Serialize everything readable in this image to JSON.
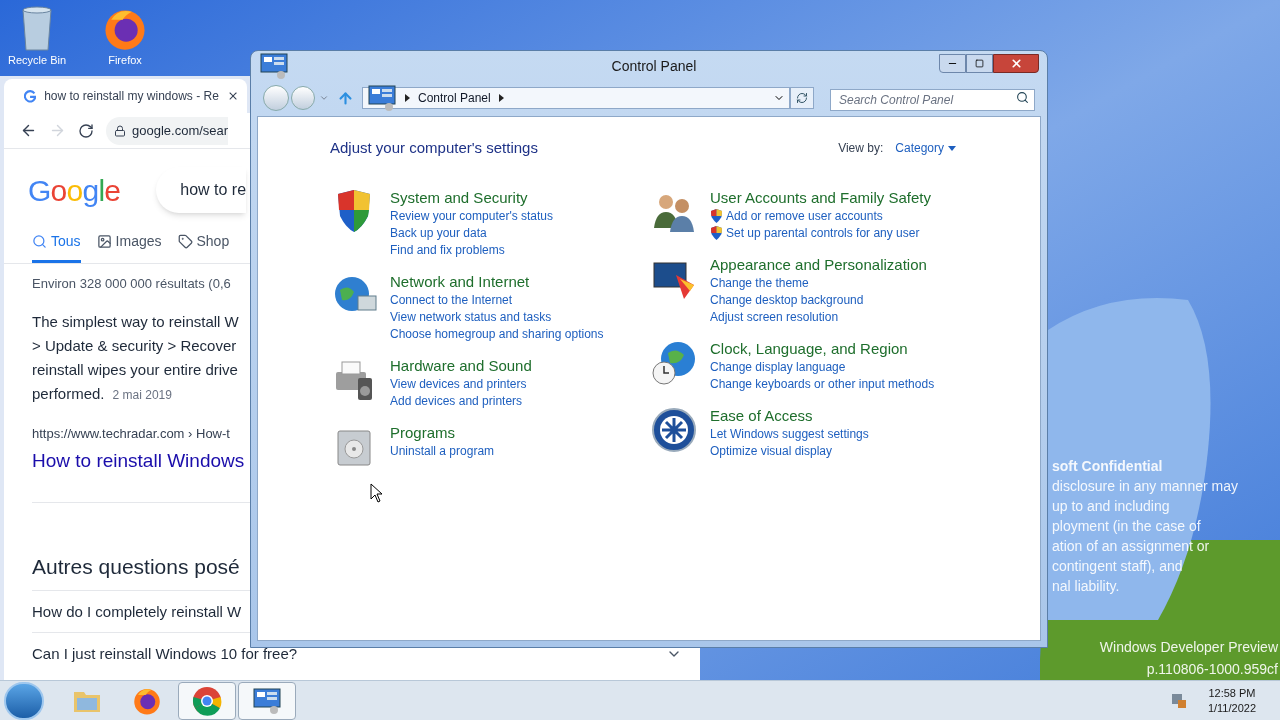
{
  "desktop": {
    "icons": [
      {
        "label": "Recycle Bin",
        "kind": "bin"
      },
      {
        "label": "Firefox",
        "kind": "firefox"
      }
    ],
    "notice_lines": [
      "soft Confidential",
      "disclosure in any manner may",
      "up to and including",
      "ployment (in the case of",
      "ation of an assignment or",
      "contingent staff), and",
      "nal liability."
    ],
    "build_lines": [
      "Windows Developer Preview",
      "p.110806-1000.959cf"
    ]
  },
  "browser": {
    "tab_title": "how to reinstall my windows - Re",
    "address": "google.com/sear",
    "logo": "Google",
    "search_query": "how to re",
    "tabs": [
      {
        "label": "Tous",
        "kind": "all",
        "selected": true
      },
      {
        "label": "Images",
        "kind": "images",
        "selected": false
      },
      {
        "label": "Shop",
        "kind": "shopping",
        "selected": false
      }
    ],
    "result_count": "Environ 328 000 000 résultats (0,6",
    "snippet_lines": [
      "The simplest way to reinstall W",
      "> Update & security > Recover",
      "reinstall wipes your entire drive",
      "performed."
    ],
    "snippet_date": "2 mai 2019",
    "result_url": "https://www.techradar.com › How-t",
    "result_title": "How to reinstall Windows",
    "section_heading": "Autres questions posé",
    "questions": [
      "How do I completely reinstall W",
      "Can I just reinstall Windows 10 for free?"
    ]
  },
  "control_panel": {
    "title": "Control Panel",
    "breadcrumb": "Control Panel",
    "search_placeholder": "Search Control Panel",
    "heading": "Adjust your computer's settings",
    "view_by_label": "View by:",
    "view_by_value": "Category",
    "columns": [
      [
        {
          "title": "System and Security",
          "kind": "security",
          "links": [
            {
              "label": "Review your computer's status",
              "shield": false
            },
            {
              "label": "Back up your data",
              "shield": false
            },
            {
              "label": "Find and fix problems",
              "shield": false
            }
          ]
        },
        {
          "title": "Network and Internet",
          "kind": "network",
          "links": [
            {
              "label": "Connect to the Internet",
              "shield": false
            },
            {
              "label": "View network status and tasks",
              "shield": false
            },
            {
              "label": "Choose homegroup and sharing options",
              "shield": false
            }
          ]
        },
        {
          "title": "Hardware and Sound",
          "kind": "hardware",
          "links": [
            {
              "label": "View devices and printers",
              "shield": false
            },
            {
              "label": "Add devices and printers",
              "shield": false
            }
          ]
        },
        {
          "title": "Programs",
          "kind": "programs",
          "links": [
            {
              "label": "Uninstall a program",
              "shield": false
            }
          ]
        }
      ],
      [
        {
          "title": "User Accounts and Family Safety",
          "kind": "users",
          "links": [
            {
              "label": "Add or remove user accounts",
              "shield": true
            },
            {
              "label": "Set up parental controls for any user",
              "shield": true
            }
          ]
        },
        {
          "title": "Appearance and Personalization",
          "kind": "appearance",
          "links": [
            {
              "label": "Change the theme",
              "shield": false
            },
            {
              "label": "Change desktop background",
              "shield": false
            },
            {
              "label": "Adjust screen resolution",
              "shield": false
            }
          ]
        },
        {
          "title": "Clock, Language, and Region",
          "kind": "clock",
          "links": [
            {
              "label": "Change display language",
              "shield": false
            },
            {
              "label": "Change keyboards or other input methods",
              "shield": false
            }
          ]
        },
        {
          "title": "Ease of Access",
          "kind": "access",
          "links": [
            {
              "label": "Let Windows suggest settings",
              "shield": false
            },
            {
              "label": "Optimize visual display",
              "shield": false
            }
          ]
        }
      ]
    ]
  },
  "taskbar": {
    "apps": [
      {
        "kind": "explorer",
        "active": false
      },
      {
        "kind": "firefox",
        "active": false
      },
      {
        "kind": "chrome",
        "active": true
      },
      {
        "kind": "control",
        "active": true
      }
    ],
    "time": "12:58 PM",
    "date": "1/11/2022"
  }
}
